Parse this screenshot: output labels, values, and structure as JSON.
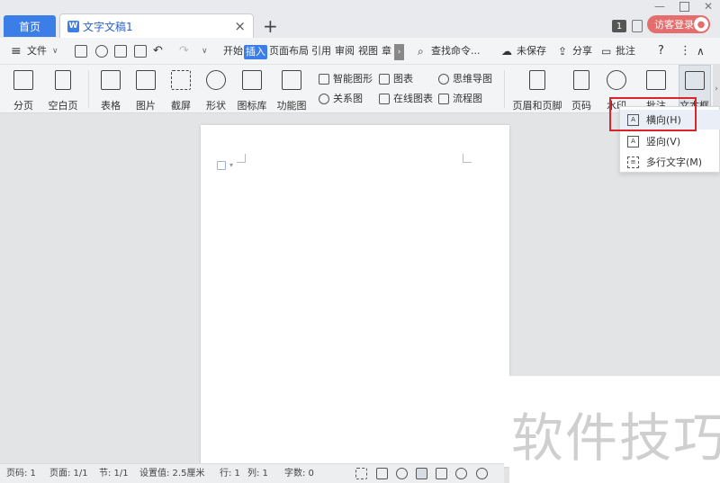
{
  "tabs": {
    "home": "首页",
    "doc": "文字文稿1",
    "close": "×",
    "new": "+"
  },
  "window": {
    "badge": "1",
    "visitor": "访客登录"
  },
  "menubar": {
    "menu_icon": "≡",
    "file": "文件",
    "items": [
      "开始",
      "插入",
      "页面布局",
      "引用",
      "审阅",
      "视图",
      "章"
    ],
    "search": "查找命令...",
    "unsaved": "未保存",
    "share": "分享",
    "comment": "批注",
    "help": "?"
  },
  "ribbon": {
    "page_break": "分页",
    "blank_page": "空白页",
    "table": "表格",
    "picture": "图片",
    "screenshot": "截屏",
    "shape": "形状",
    "icon_lib": "图标库",
    "func_chart": "功能图",
    "smart_art": "智能图形",
    "chart": "图表",
    "mind_map": "思维导图",
    "relation": "关系图",
    "online_chart": "在线图表",
    "flow_chart": "流程图",
    "header_footer": "页眉和页脚",
    "page_number": "页码",
    "watermark": "水印",
    "comment": "批注",
    "textbox": "文本框"
  },
  "popup": {
    "items": [
      "横向(H)",
      "竖向(V)",
      "多行文字(M)"
    ]
  },
  "status": {
    "page_num": "页码: 1",
    "pages": "页面: 1/1",
    "section": "节: 1/1",
    "setting": "设置值: 2.5厘米",
    "row": "行: 1",
    "col": "列: 1",
    "words": "字数: 0"
  },
  "watermark_text": "软件技巧"
}
